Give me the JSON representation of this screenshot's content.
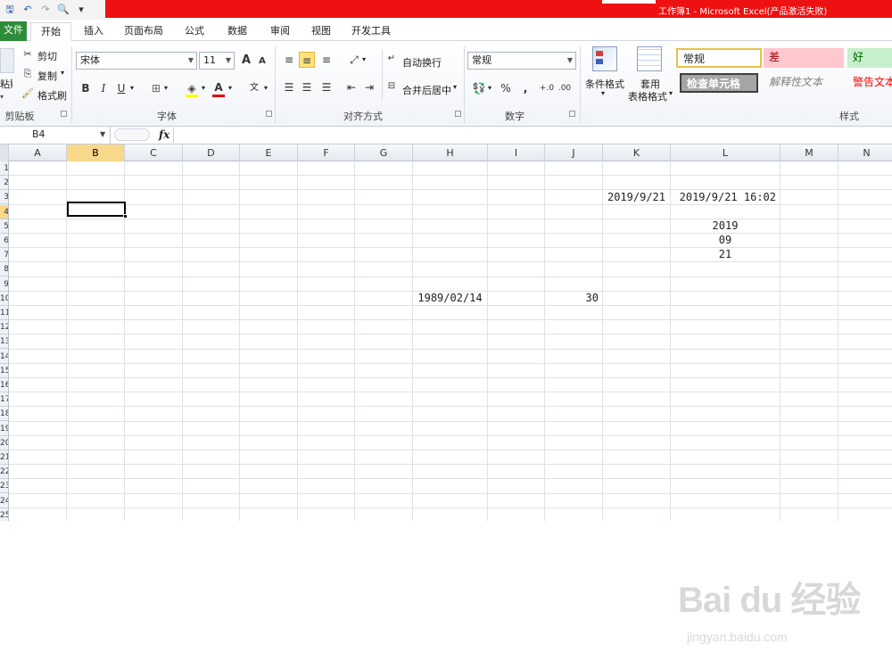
{
  "window": {
    "title": "工作簿1 - Microsoft Excel(产品激活失败)"
  },
  "quick_access": {
    "icons": [
      "save-icon",
      "undo-icon",
      "redo-icon",
      "print-preview-icon",
      "customize-icon"
    ]
  },
  "tabs": [
    {
      "label": "文件",
      "active": false
    },
    {
      "label": "开始",
      "active": true
    },
    {
      "label": "插入",
      "active": false
    },
    {
      "label": "页面布局",
      "active": false
    },
    {
      "label": "公式",
      "active": false
    },
    {
      "label": "数据",
      "active": false
    },
    {
      "label": "审阅",
      "active": false
    },
    {
      "label": "视图",
      "active": false
    },
    {
      "label": "开发工具",
      "active": false
    }
  ],
  "ribbon": {
    "clipboard": {
      "paste": "粘贴",
      "cut": "剪切",
      "copy": "复制",
      "format_painter": "格式刷",
      "label": "剪贴板"
    },
    "font": {
      "name": "宋体",
      "size": "11",
      "grow": "A",
      "shrink": "A",
      "bold": "B",
      "italic": "I",
      "underline": "U",
      "label": "字体"
    },
    "alignment": {
      "wrap_text": "自动换行",
      "merge_center": "合并后居中",
      "label": "对齐方式"
    },
    "number": {
      "format": "常规",
      "percent": "%",
      "comma": ",",
      "label": "数字"
    },
    "styles": {
      "conditional_format": "条件格式",
      "format_as_table_1": "套用",
      "format_as_table_2": "表格格式",
      "normal": "常规",
      "bad": "差",
      "good": "好",
      "check_cell": "检查单元格",
      "explanatory": "解释性文本",
      "warning": "警告文本",
      "label": "样式"
    }
  },
  "formula_bar": {
    "name_box": "B4",
    "fx": "fx"
  },
  "columns": [
    "A",
    "B",
    "C",
    "D",
    "E",
    "F",
    "G",
    "H",
    "I",
    "J",
    "K",
    "L",
    "M",
    "N"
  ],
  "selected_column": "B",
  "row_labels": [
    "1",
    "2",
    "3",
    "4",
    "5",
    "6",
    "7",
    "8",
    "9",
    "10",
    "11",
    "12",
    "13",
    "14",
    "15",
    "16",
    "17",
    "18",
    "19",
    "20",
    "21",
    "22",
    "23",
    "24",
    "25"
  ],
  "cells": {
    "K3": "2019/9/21",
    "L3": "2019/9/21 16:02",
    "L5": "2019",
    "L6": "09",
    "L7": "21",
    "H9": "1989/02/14",
    "J9": "30"
  },
  "watermark": {
    "logo": "Bai du 经验",
    "url": "jingyan.baidu.com"
  }
}
